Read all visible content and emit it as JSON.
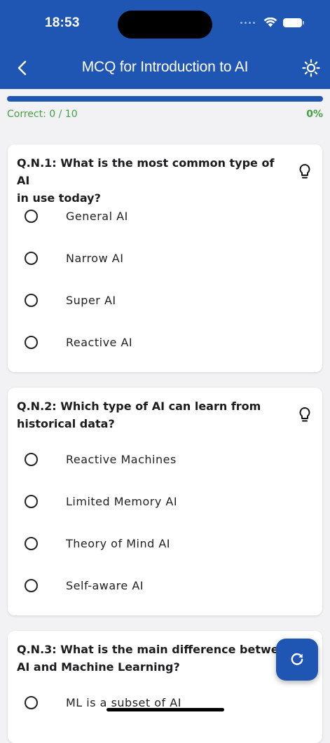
{
  "status_bar": {
    "time": "18:53"
  },
  "header": {
    "title": "MCQ for Introduction to AI",
    "back_icon": "chevron-left-icon",
    "theme_icon": "sun-icon"
  },
  "progress": {
    "correct_label": "Correct: 0 / 10",
    "percent_label": "0%",
    "fraction": 0
  },
  "colors": {
    "primary": "#1f56b3",
    "success": "#43a047",
    "background": "#f2f2f4"
  },
  "questions": [
    {
      "text": "Q.N.1: What is the most common type of AI\nin use today?",
      "hint_icon": "lightbulb-icon",
      "options": [
        "General AI",
        "Narrow AI",
        "Super AI",
        "Reactive AI"
      ]
    },
    {
      "text": "Q.N.2: Which type of AI can learn from\nhistorical data?",
      "hint_icon": "lightbulb-icon",
      "options": [
        "Reactive Machines",
        "Limited Memory AI",
        "Theory of Mind AI",
        "Self-aware AI"
      ]
    },
    {
      "text": "Q.N.3: What is the main difference between\nAI and Machine Learning?",
      "options": [
        "ML is a subset of AI"
      ]
    }
  ],
  "fab": {
    "icon": "refresh-icon"
  }
}
